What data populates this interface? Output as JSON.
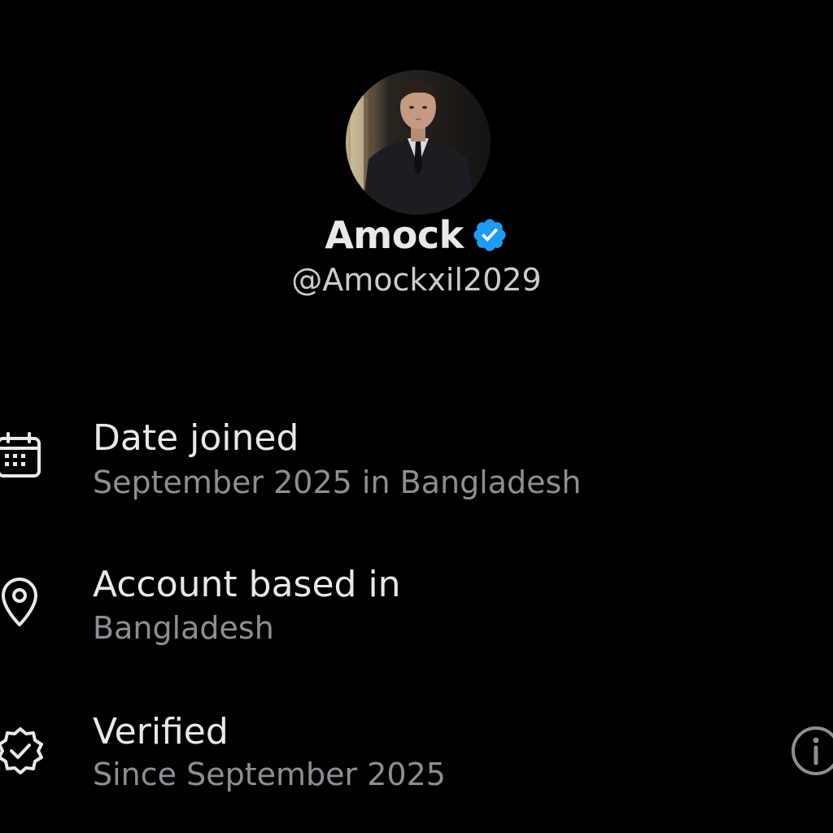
{
  "profile": {
    "name": "Amock",
    "handle": "@Amockxil2029",
    "avatar_icon": "profile-photo",
    "verified_icon": "verified-badge-icon",
    "accent_color": "#1d9bf0"
  },
  "details": [
    {
      "icon": "calendar-icon",
      "title": "Date joined",
      "subtitle": "September 2025 in Bangladesh"
    },
    {
      "icon": "location-pin-icon",
      "title": "Account based in",
      "subtitle": "Bangladesh"
    },
    {
      "icon": "verified-check-icon",
      "title": "Verified",
      "subtitle": "Since September 2025",
      "action_icon": "info-icon"
    }
  ]
}
